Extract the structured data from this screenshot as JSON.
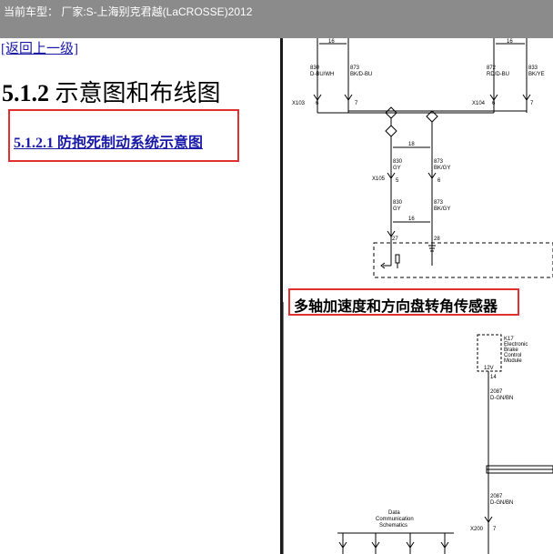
{
  "topbar": {
    "text": "当前车型： 厂家:S-上海别克君越(LaCROSSE)2012"
  },
  "back_link": {
    "label": "[返回上一级]"
  },
  "section": {
    "number": "5.1.2",
    "title": "示意图和布线图",
    "sub_link": "5.1.2.1 防抱死制动系统示意图"
  },
  "diagram": {
    "highlight_label": "多轴加速度和方向盘转角传感器",
    "wire_labels": {
      "w830_top": "830",
      "w830_top_color": "D-BU/WH",
      "w873_top": "873",
      "w873_top_color": "BK/D-BU",
      "w872": "872",
      "w872_color": "RD/D-BU",
      "w833": "833",
      "w833_color": "BK/YE",
      "gauge16_a": "16",
      "gauge16_b": "16",
      "gauge18": "18",
      "gauge16_c": "16",
      "w830_mid": "830",
      "w830_mid_color": "GY",
      "w873_mid": "873",
      "w873_mid_color": "BK/GY",
      "w830_low": "830",
      "w830_low_color": "GY",
      "w873_low": "873",
      "w873_low_color": "BK/GY",
      "w2087_a": "2087",
      "w2087_a_color": "D-GN/BN",
      "w2087_b": "2087",
      "w2087_b_color": "D-GN/BN"
    },
    "connectors": {
      "x103": "X103",
      "x104": "X104",
      "x105": "X105",
      "x200": "X200",
      "pin6_a": "6",
      "pin7_a": "7",
      "pin6_b": "6",
      "pin7_b": "7",
      "pin5": "5",
      "pin6_c": "6",
      "pin27": "27",
      "pin28": "28",
      "pin14": "14",
      "pin7_c": "7"
    },
    "module": {
      "id": "K17",
      "line1": "Electronic",
      "line2": "Brake",
      "line3": "Control",
      "line4": "Module",
      "voltage": "12V"
    },
    "data_comm": {
      "line1": "Data",
      "line2": "Communication",
      "line3": "Schematics"
    }
  }
}
